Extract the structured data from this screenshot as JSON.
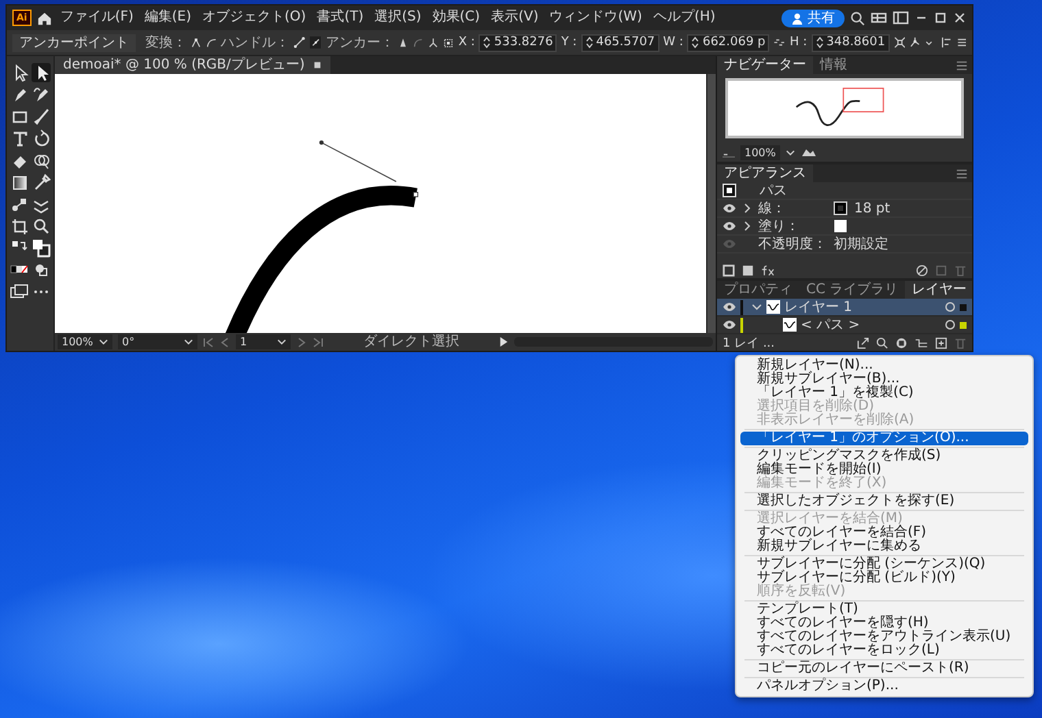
{
  "app": {
    "logo": "Ai"
  },
  "menubar": [
    "ファイル(F)",
    "編集(E)",
    "オブジェクト(O)",
    "書式(T)",
    "選択(S)",
    "効果(C)",
    "表示(V)",
    "ウィンドウ(W)",
    "ヘルプ(H)"
  ],
  "share_button": "共有",
  "control_bar": {
    "tool": "アンカーポイント",
    "convert_label": "変換：",
    "handle_label": "ハンドル：",
    "anchor_label": "アンカー：",
    "fields": [
      {
        "label": "X :",
        "value": "533.8276"
      },
      {
        "label": "Y :",
        "value": "465.5707"
      },
      {
        "label": "W :",
        "value": "662.069 p"
      },
      {
        "label": "H :",
        "value": "348.8601"
      }
    ]
  },
  "document_tab": {
    "title": "demoai* @ 100 % (RGB/プレビュー)"
  },
  "tools": [
    {
      "selected": false
    },
    {
      "selected": true
    },
    {
      "selected": false
    },
    {
      "selected": false
    },
    {
      "selected": false
    },
    {
      "selected": false
    },
    {
      "selected": false
    },
    {
      "selected": false
    },
    {
      "selected": false
    },
    {
      "selected": false
    },
    {
      "selected": false
    },
    {
      "selected": false
    },
    {
      "selected": false
    },
    {
      "selected": false
    },
    {
      "selected": false
    },
    {
      "selected": false
    }
  ],
  "status_bar": {
    "zoom": "100%",
    "rotation": "0°",
    "artboard": "1",
    "tool": "ダイレクト選択"
  },
  "navigator": {
    "tabs": [
      {
        "label": "ナビゲーター",
        "selected": true
      },
      {
        "label": "情報",
        "selected": false
      }
    ],
    "zoom": "100%"
  },
  "appearance": {
    "title": "アピアランス",
    "object": "パス",
    "rows": [
      {
        "kind": "stroke",
        "label": "線：",
        "value": "18 pt",
        "visible": true
      },
      {
        "kind": "fill",
        "label": "塗り：",
        "visible": true
      },
      {
        "kind": "opacity",
        "label": "不透明度：",
        "value": "初期設定",
        "visible": false
      }
    ]
  },
  "layers": {
    "tabs": [
      {
        "label": "プロパティ",
        "selected": false
      },
      {
        "label": "CC ライブラリ",
        "selected": false
      },
      {
        "label": "レイヤー",
        "selected": true
      }
    ],
    "rows": [
      {
        "name": "レイヤー 1",
        "selected": true,
        "expanded": true,
        "children": [
          {
            "name": "< パス >",
            "selected": false
          }
        ]
      }
    ],
    "footer": "1 レイ ..."
  },
  "context_menu": {
    "items": [
      {
        "kind": "item",
        "label": "新規レイヤー(N)...",
        "disabled": false,
        "selected": false
      },
      {
        "kind": "item",
        "label": "新規サブレイヤー(B)...",
        "disabled": false,
        "selected": false
      },
      {
        "kind": "item",
        "label": "「レイヤー 1」を複製(C)",
        "disabled": false,
        "selected": false
      },
      {
        "kind": "item",
        "label": "選択項目を削除(D)",
        "disabled": true,
        "selected": false
      },
      {
        "kind": "item",
        "label": "非表示レイヤーを削除(A)",
        "disabled": true,
        "selected": false
      },
      {
        "kind": "separator"
      },
      {
        "kind": "item",
        "label": "「レイヤー 1」のオプション(O)...",
        "disabled": false,
        "selected": true
      },
      {
        "kind": "separator"
      },
      {
        "kind": "item",
        "label": "クリッピングマスクを作成(S)",
        "disabled": false,
        "selected": false
      },
      {
        "kind": "item",
        "label": "編集モードを開始(I)",
        "disabled": false,
        "selected": false
      },
      {
        "kind": "item",
        "label": "編集モードを終了(X)",
        "disabled": true,
        "selected": false
      },
      {
        "kind": "separator"
      },
      {
        "kind": "item",
        "label": "選択したオブジェクトを探す(E)",
        "disabled": false,
        "selected": false
      },
      {
        "kind": "separator"
      },
      {
        "kind": "item",
        "label": "選択レイヤーを結合(M)",
        "disabled": true,
        "selected": false
      },
      {
        "kind": "item",
        "label": "すべてのレイヤーを結合(F)",
        "disabled": false,
        "selected": false
      },
      {
        "kind": "item",
        "label": "新規サブレイヤーに集める",
        "disabled": false,
        "selected": false
      },
      {
        "kind": "separator"
      },
      {
        "kind": "item",
        "label": "サブレイヤーに分配 (シーケンス)(Q)",
        "disabled": false,
        "selected": false
      },
      {
        "kind": "item",
        "label": "サブレイヤーに分配 (ビルド)(Y)",
        "disabled": false,
        "selected": false
      },
      {
        "kind": "item",
        "label": "順序を反転(V)",
        "disabled": true,
        "selected": false
      },
      {
        "kind": "separator"
      },
      {
        "kind": "item",
        "label": "テンプレート(T)",
        "disabled": false,
        "selected": false
      },
      {
        "kind": "item",
        "label": "すべてのレイヤーを隠す(H)",
        "disabled": false,
        "selected": false
      },
      {
        "kind": "item",
        "label": "すべてのレイヤーをアウトライン表示(U)",
        "disabled": false,
        "selected": false
      },
      {
        "kind": "item",
        "label": "すべてのレイヤーをロック(L)",
        "disabled": false,
        "selected": false
      },
      {
        "kind": "separator"
      },
      {
        "kind": "item",
        "label": "コピー元のレイヤーにペースト(R)",
        "disabled": false,
        "selected": false
      },
      {
        "kind": "separator"
      },
      {
        "kind": "item",
        "label": "パネルオプション(P)...",
        "disabled": false,
        "selected": false
      }
    ]
  }
}
